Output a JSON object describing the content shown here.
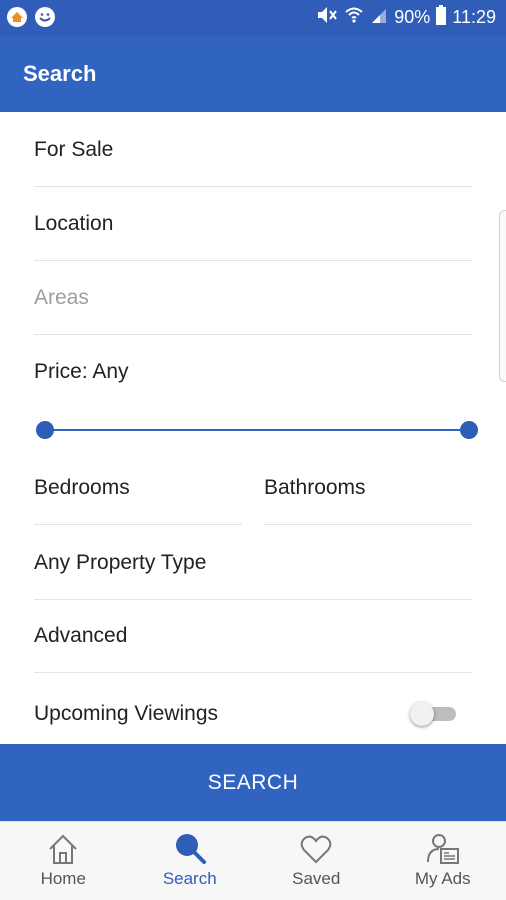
{
  "status_bar": {
    "battery": "90%",
    "time": "11:29",
    "icons": [
      "app-notification-icon",
      "smiley-notification-icon",
      "mute-icon",
      "wifi-icon",
      "signal-icon",
      "battery-icon"
    ]
  },
  "app_bar": {
    "title": "Search"
  },
  "form": {
    "listing_type": "For Sale",
    "location": "Location",
    "areas_placeholder": "Areas",
    "price_label": "Price: Any",
    "price_slider": {
      "min_fraction": 0.0,
      "max_fraction": 1.0
    },
    "bedrooms": "Bedrooms",
    "bathrooms": "Bathrooms",
    "property_type": "Any Property Type",
    "advanced": "Advanced",
    "upcoming_viewings": "Upcoming Viewings",
    "upcoming_viewings_enabled": false
  },
  "search_button": {
    "label": "SEARCH"
  },
  "bottom_nav": {
    "items": [
      {
        "label": "Home",
        "icon": "home-icon",
        "active": false
      },
      {
        "label": "Search",
        "icon": "search-icon",
        "active": true
      },
      {
        "label": "Saved",
        "icon": "heart-icon",
        "active": false
      },
      {
        "label": "My Ads",
        "icon": "my-ads-icon",
        "active": false
      }
    ]
  },
  "colors": {
    "primary": "#3163c0",
    "status_bar": "#2f5db7",
    "placeholder": "#9e9e9e",
    "divider": "#e3e3e3"
  }
}
